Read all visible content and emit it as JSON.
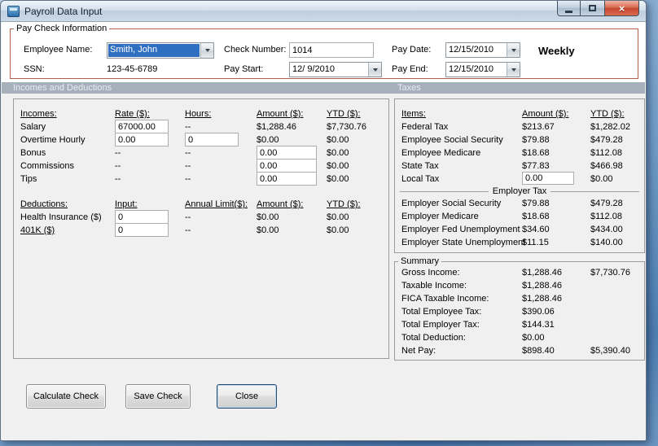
{
  "window": {
    "title": "Payroll Data Input"
  },
  "icons": {
    "close": "×",
    "minimize": "minimize-bar",
    "maximize": "maximize-square",
    "dropdown": "chevron-down"
  },
  "colors": {
    "paycheck_border": "#b2604e",
    "selection_bg": "#2f6fc1",
    "strip_bg": "#a6b1bc",
    "strip_text": "#e9edf1",
    "close_btn": "#c84631",
    "window_bg": "#f0f0f0"
  },
  "paycheck": {
    "legend": "Pay Check Information",
    "fields": {
      "employee_name": {
        "label": "Employee Name:",
        "value": "Smith, John"
      },
      "ssn": {
        "label": "SSN:",
        "value": "123-45-6789"
      },
      "check_number": {
        "label": "Check Number:",
        "value": "1014"
      },
      "pay_start": {
        "label": "Pay Start:",
        "value": "12/ 9/2010"
      },
      "pay_date": {
        "label": "Pay Date:",
        "value": "12/15/2010"
      },
      "pay_end": {
        "label": "Pay End:",
        "value": "12/15/2010"
      }
    },
    "frequency": "Weekly"
  },
  "section_headers": {
    "incomes_deductions": "Incomes and Deductions",
    "taxes": "Taxes"
  },
  "incomes": {
    "headers": {
      "name": "Incomes:",
      "rate": "Rate ($):",
      "hours": "Hours:",
      "amount": "Amount ($):",
      "ytd": "YTD ($):"
    },
    "rows": [
      {
        "label": "Salary",
        "rate": "67000.00",
        "hours": "--",
        "amount": "$1,288.46",
        "ytd": "$7,730.76"
      },
      {
        "label": "Overtime Hourly",
        "rate": "0.00",
        "hours": "0",
        "amount": "$0.00",
        "ytd": "$0.00"
      },
      {
        "label": "Bonus",
        "rate": "--",
        "hours": "--",
        "amount": "0.00",
        "ytd": "$0.00"
      },
      {
        "label": "Commissions",
        "rate": "--",
        "hours": "--",
        "amount": "0.00",
        "ytd": "$0.00"
      },
      {
        "label": "Tips",
        "rate": "--",
        "hours": "--",
        "amount": "0.00",
        "ytd": "$0.00"
      }
    ]
  },
  "deductions": {
    "headers": {
      "name": "Deductions:",
      "input": "Input:",
      "annual_limit": "Annual Limit($):",
      "amount": "Amount ($):",
      "ytd": "YTD ($):"
    },
    "rows": [
      {
        "label": "Health Insurance  ($)",
        "input": "0",
        "annual_limit": "--",
        "amount": "$0.00",
        "ytd": "$0.00"
      },
      {
        "label": "401K  ($)",
        "input": "0",
        "annual_limit": "--",
        "amount": "$0.00",
        "ytd": "$0.00"
      }
    ]
  },
  "taxes": {
    "headers": {
      "items": "Items:",
      "amount": "Amount ($):",
      "ytd": "YTD ($):"
    },
    "employee_rows": [
      {
        "label": "Federal Tax",
        "amount": "$213.67",
        "ytd": "$1,282.02"
      },
      {
        "label": "Employee Social Security",
        "amount": "$79.88",
        "ytd": "$479.28"
      },
      {
        "label": "Employee Medicare",
        "amount": "$18.68",
        "ytd": "$112.08"
      },
      {
        "label": "State Tax",
        "amount": "$77.83",
        "ytd": "$466.98"
      },
      {
        "label": "Local Tax",
        "amount": "0.00",
        "ytd": "$0.00"
      }
    ],
    "employer_header": "Employer Tax",
    "employer_rows": [
      {
        "label": "Employer Social Security",
        "amount": "$79.88",
        "ytd": "$479.28"
      },
      {
        "label": "Employer Medicare",
        "amount": "$18.68",
        "ytd": "$112.08"
      },
      {
        "label": "Employer Fed Unemployment",
        "amount": "$34.60",
        "ytd": "$434.00"
      },
      {
        "label": "Employer State Unemployment",
        "amount": "$11.15",
        "ytd": "$140.00"
      }
    ]
  },
  "summary": {
    "legend": "Summary",
    "rows": [
      {
        "label": "Gross Income:",
        "amount": "$1,288.46",
        "ytd": "$7,730.76"
      },
      {
        "label": "Taxable Income:",
        "amount": "$1,288.46",
        "ytd": ""
      },
      {
        "label": "FICA Taxable Income:",
        "amount": "$1,288.46",
        "ytd": ""
      },
      {
        "label": "Total Employee Tax:",
        "amount": "$390.06",
        "ytd": ""
      },
      {
        "label": "Total Employer Tax:",
        "amount": "$144.31",
        "ytd": ""
      },
      {
        "label": "Total Deduction:",
        "amount": "$0.00",
        "ytd": ""
      },
      {
        "label": "Net Pay:",
        "amount": "$898.40",
        "ytd": "$5,390.40"
      }
    ]
  },
  "buttons": {
    "calculate": "Calculate Check",
    "save": "Save Check",
    "close": "Close"
  }
}
